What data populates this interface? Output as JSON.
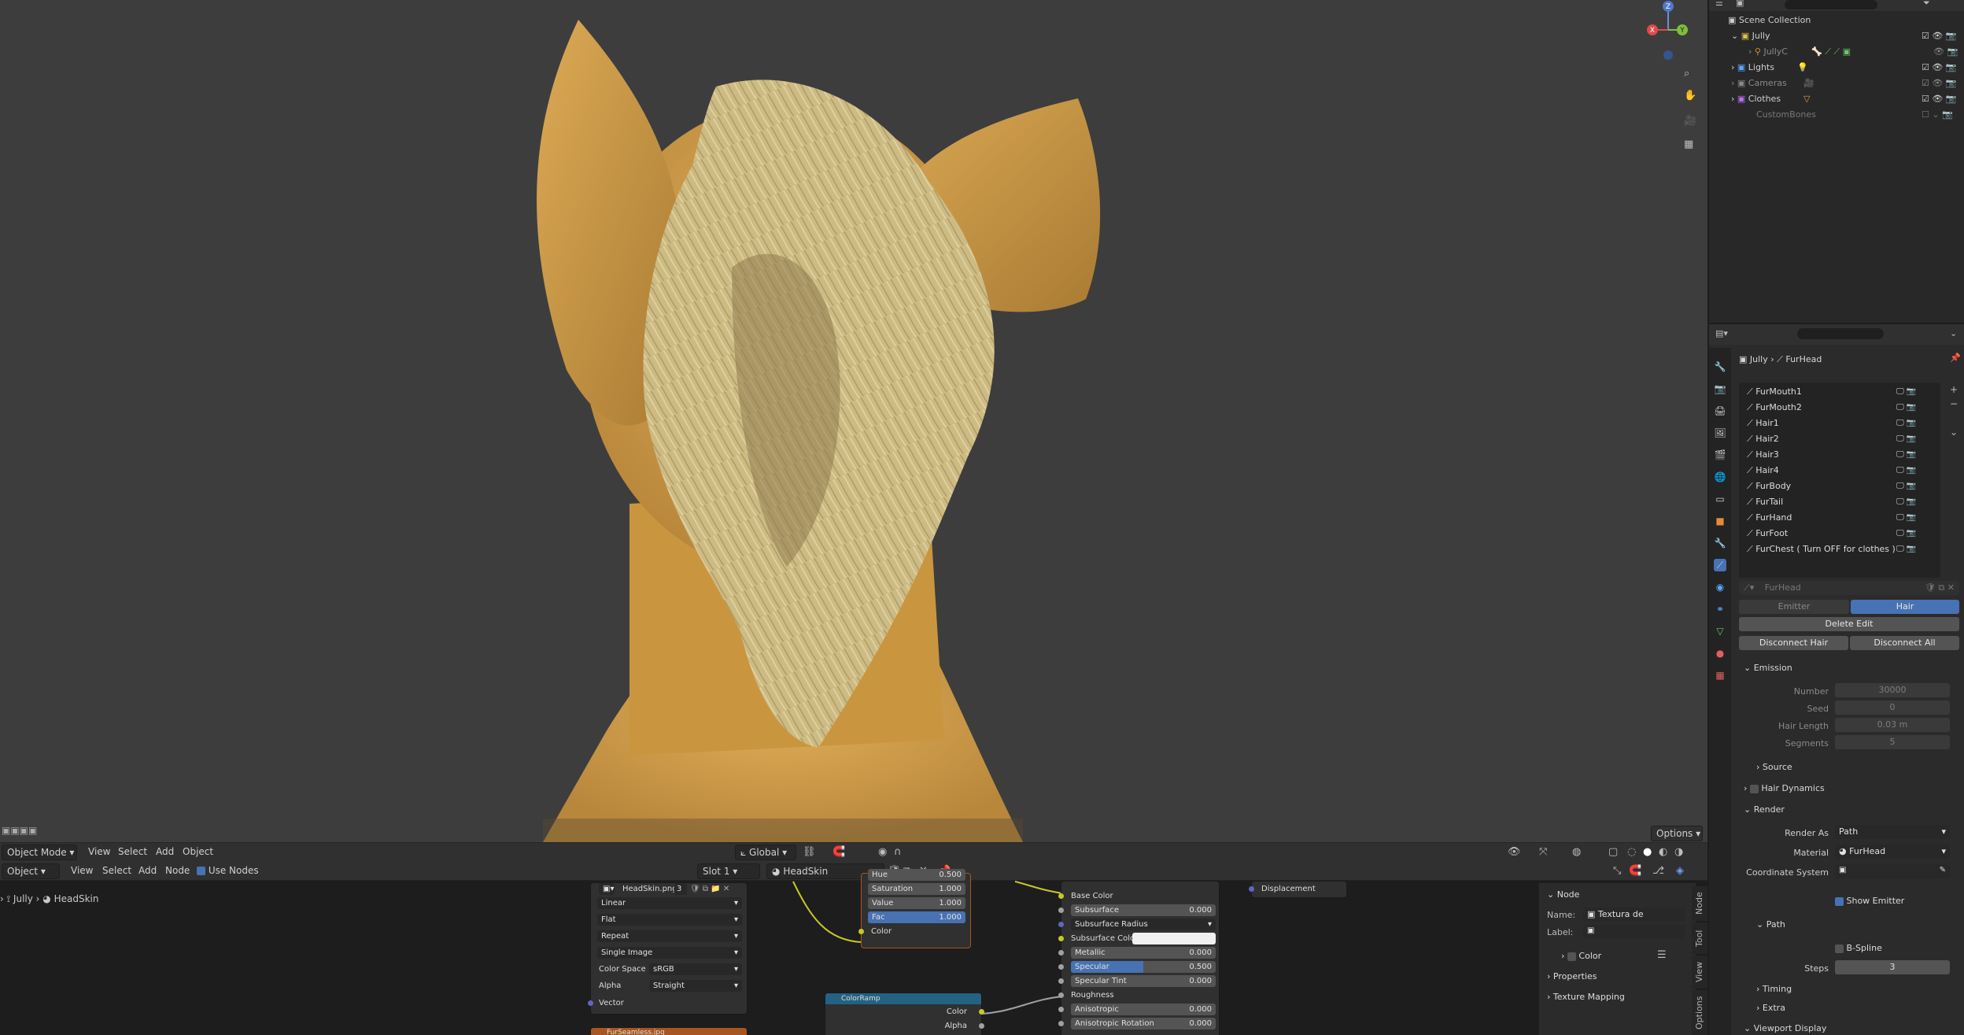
{
  "viewport": {
    "header": {
      "mode": "Object Mode",
      "menus": [
        "View",
        "Select",
        "Add",
        "Object"
      ],
      "transform_orientation": "Global",
      "options_label": "Options"
    },
    "gizmo": {
      "z": "Z",
      "y": "Y",
      "x": "X"
    }
  },
  "node_editor": {
    "header": {
      "editor_type": "Object",
      "menus": [
        "View",
        "Select",
        "Add",
        "Node"
      ],
      "use_nodes_label": "Use Nodes",
      "use_nodes_checked": true,
      "slot": "Slot 1",
      "material": "HeadSkin"
    },
    "breadcrumb": {
      "object": "Jully",
      "material": "HeadSkin"
    },
    "image_node": {
      "image_name": "HeadSkin.png",
      "users": "3",
      "interpolation": "Linear",
      "projection": "Flat",
      "extension": "Repeat",
      "source": "Single Image",
      "color_space_label": "Color Space",
      "color_space": "sRGB",
      "alpha_label": "Alpha",
      "alpha": "Straight",
      "vector_label": "Vector"
    },
    "next_image_node": {
      "title": "FurSeamless.jpg"
    },
    "hsv_node": {
      "hue_label": "Hue",
      "hue_value": "0.500",
      "saturation_label": "Saturation",
      "saturation_value": "1.000",
      "value_label": "Value",
      "value_value": "1.000",
      "fac_label": "Fac",
      "fac_value": "1.000",
      "color_label": "Color"
    },
    "colorramp_node": {
      "title": "ColorRamp",
      "color_label": "Color",
      "alpha_label": "Alpha"
    },
    "bsdf_node": {
      "base_color": "Base Color",
      "subsurface_label": "Subsurface",
      "subsurface_value": "0.000",
      "subsurface_radius": "Subsurface Radius",
      "subsurface_color": "Subsurface Color",
      "metallic_label": "Metallic",
      "metallic_value": "0.000",
      "specular_label": "Specular",
      "specular_value": "0.500",
      "specular_tint_label": "Specular Tint",
      "specular_tint_value": "0.000",
      "roughness": "Roughness",
      "anisotropic_label": "Anisotropic",
      "anisotropic_value": "0.000",
      "anisotropic_rotation_label": "Anisotropic Rotation",
      "anisotropic_rotation_value": "0.000"
    },
    "output_node": {
      "displacement": "Displacement"
    },
    "side_panel": {
      "section": "Node",
      "name_label": "Name:",
      "name_value": "Textura de imagem",
      "label_label": "Label:",
      "color_label": "Color",
      "properties_label": "Properties",
      "texture_mapping_label": "Texture Mapping",
      "tabs": [
        "Node",
        "Tool",
        "View",
        "Options"
      ]
    }
  },
  "outliner": {
    "root": "Scene Collection",
    "items": [
      {
        "name": "Jully",
        "depth": 1,
        "dim": false
      },
      {
        "name": "JullyC",
        "depth": 2,
        "dim": true
      },
      {
        "name": "Lights",
        "depth": 1,
        "dim": false
      },
      {
        "name": "Cameras",
        "depth": 1,
        "dim": true
      },
      {
        "name": "Clothes",
        "depth": 1,
        "dim": false
      },
      {
        "name": "CustomBones",
        "depth": 1,
        "dim": true
      }
    ]
  },
  "properties": {
    "breadcrumb": {
      "object": "Jully",
      "system": "FurHead"
    },
    "particle_systems": [
      "FurMouth1",
      "FurMouth2",
      "Hair1",
      "Hair2",
      "Hair3",
      "Hair4",
      "FurBody",
      "FurTail",
      "FurHand",
      "FurFoot",
      "FurChest ( Turn OFF for clothes )"
    ],
    "settings_name": "FurHead",
    "type_emitter": "Emitter",
    "type_hair": "Hair",
    "delete_edit": "Delete Edit",
    "disconnect_hair": "Disconnect Hair",
    "disconnect_all": "Disconnect All",
    "emission": {
      "title": "Emission",
      "number_label": "Number",
      "number_value": "30000",
      "seed_label": "Seed",
      "seed_value": "0",
      "hair_length_label": "Hair Length",
      "hair_length_value": "0.03 m",
      "segments_label": "Segments",
      "segments_value": "5",
      "source_label": "Source"
    },
    "hair_dynamics": "Hair Dynamics",
    "render": {
      "title": "Render",
      "render_as_label": "Render As",
      "render_as_value": "Path",
      "material_label": "Material",
      "material_value": "FurHead",
      "coord_label": "Coordinate System",
      "show_emitter_label": "Show Emitter",
      "path_label": "Path",
      "bspline_label": "B-Spline",
      "steps_label": "Steps",
      "steps_value": "3",
      "timing_label": "Timing",
      "extra_label": "Extra"
    },
    "viewport_display": "Viewport Display"
  },
  "colors": {
    "accent_blue": "#4772b3",
    "viewport_bg": "#3d3d3d",
    "skin": "#d2a14f",
    "fur": "#cdbb84"
  }
}
